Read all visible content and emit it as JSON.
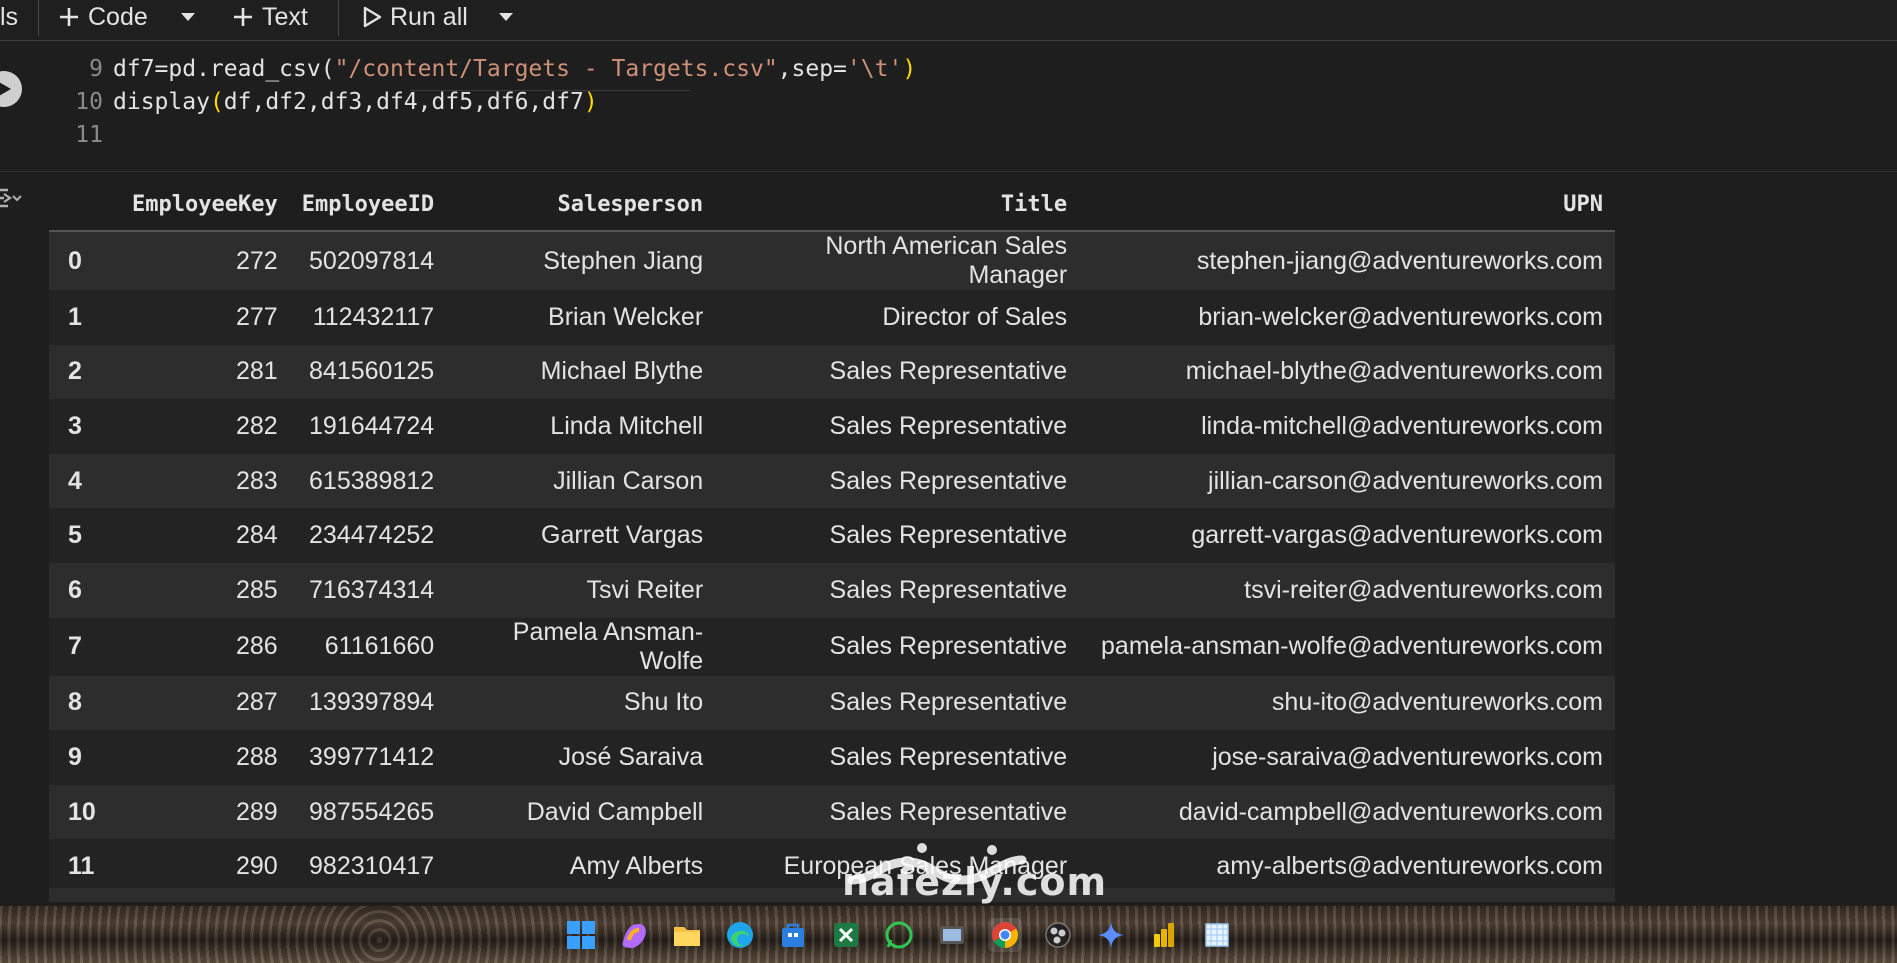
{
  "toolbar": {
    "left_fragment": "ls",
    "code_label": "Code",
    "text_label": "Text",
    "run_all_label": "Run all"
  },
  "code": {
    "lines": [
      {
        "num": "9",
        "pre": "df7=pd.read_csv(",
        "str": "\"/content/Targets - Targets.csv\"",
        "mid": ",sep=",
        "str2": "'\\t'",
        "post": ")"
      },
      {
        "num": "10",
        "pre": "display",
        "args": "df,df2,df3,df4,df5,df6,df7"
      },
      {
        "num": "11"
      }
    ]
  },
  "table": {
    "columns": [
      "",
      "EmployeeKey",
      "EmployeeID",
      "Salesperson",
      "Title",
      "UPN"
    ],
    "rows": [
      [
        "0",
        "272",
        "502097814",
        "Stephen Jiang",
        "North American Sales Manager",
        "stephen-jiang@adventureworks.com"
      ],
      [
        "1",
        "277",
        "112432117",
        "Brian Welcker",
        "Director of Sales",
        "brian-welcker@adventureworks.com"
      ],
      [
        "2",
        "281",
        "841560125",
        "Michael Blythe",
        "Sales Representative",
        "michael-blythe@adventureworks.com"
      ],
      [
        "3",
        "282",
        "191644724",
        "Linda Mitchell",
        "Sales Representative",
        "linda-mitchell@adventureworks.com"
      ],
      [
        "4",
        "283",
        "615389812",
        "Jillian Carson",
        "Sales Representative",
        "jillian-carson@adventureworks.com"
      ],
      [
        "5",
        "284",
        "234474252",
        "Garrett Vargas",
        "Sales Representative",
        "garrett-vargas@adventureworks.com"
      ],
      [
        "6",
        "285",
        "716374314",
        "Tsvi Reiter",
        "Sales Representative",
        "tsvi-reiter@adventureworks.com"
      ],
      [
        "7",
        "286",
        "61161660",
        "Pamela Ansman-Wolfe",
        "Sales Representative",
        "pamela-ansman-wolfe@adventureworks.com"
      ],
      [
        "8",
        "287",
        "139397894",
        "Shu Ito",
        "Sales Representative",
        "shu-ito@adventureworks.com"
      ],
      [
        "9",
        "288",
        "399771412",
        "José Saraiva",
        "Sales Representative",
        "jose-saraiva@adventureworks.com"
      ],
      [
        "10",
        "289",
        "987554265",
        "David Campbell",
        "Sales Representative",
        "david-campbell@adventureworks.com"
      ],
      [
        "11",
        "290",
        "982310417",
        "Amy Alberts",
        "European Sales Manager",
        "amy-alberts@adventureworks.com"
      ]
    ]
  },
  "watermark": {
    "text": "nafezly.com"
  },
  "taskbar": {
    "icons": [
      "windows-start-icon",
      "copilot-icon",
      "file-explorer-icon",
      "edge-icon",
      "store-icon",
      "excel-icon",
      "whatsapp-icon",
      "media-icon",
      "chrome-icon",
      "obs-icon",
      "gemini-icon",
      "power-bi-icon",
      "snipping-icon"
    ]
  }
}
